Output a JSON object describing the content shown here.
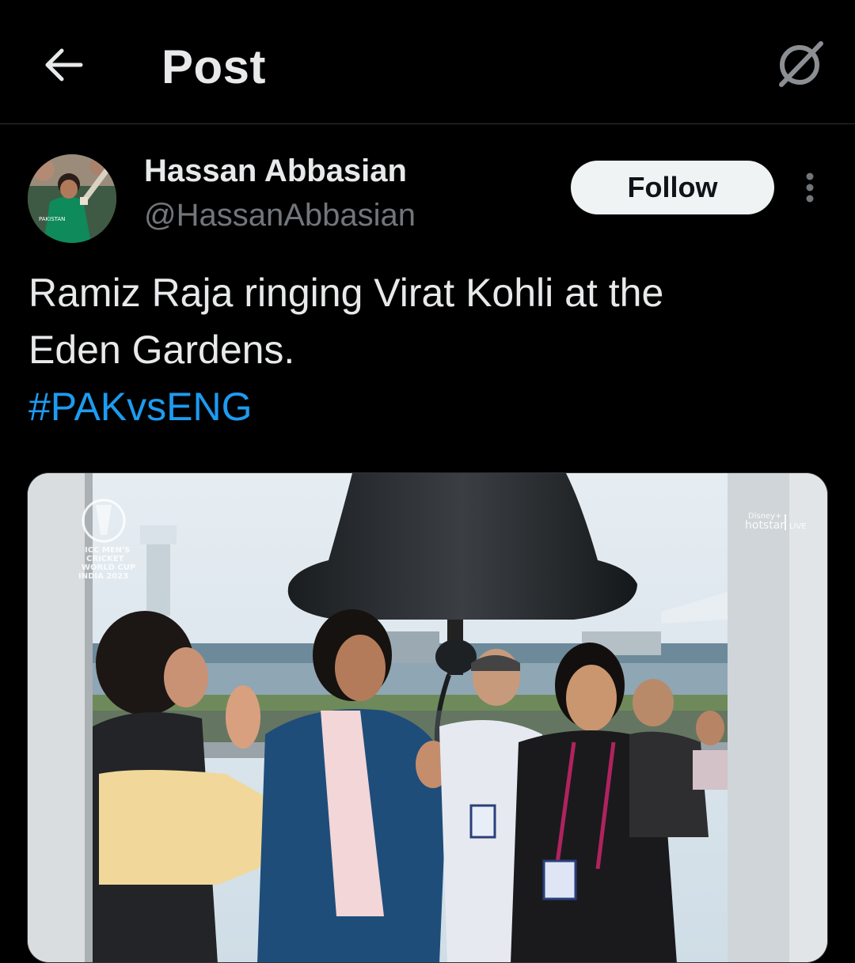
{
  "header": {
    "title": "Post",
    "back_icon": "arrow-left-icon",
    "grok_icon": "grok-icon"
  },
  "author": {
    "name": "Hassan Abbasian",
    "handle": "@HassanAbbasian",
    "avatar_icon": "avatar-photo"
  },
  "follow_label": "Follow",
  "more_icon": "more-vertical-icon",
  "post": {
    "line1": "Ramiz Raja ringing Virat Kohli at the",
    "line2": "Eden Gardens.",
    "hashtag": "#PAKvsENG"
  },
  "media": {
    "logo_text_1": "ICC MEN'S",
    "logo_text_2": "CRICKET",
    "logo_text_3": "WORLD CUP",
    "logo_text_4": "INDIA 2023",
    "broadcaster": "hotstar",
    "broadcaster_sub": "Disney+",
    "live_label": "LIVE"
  },
  "colors": {
    "background": "#000000",
    "text": "#e7e9ea",
    "secondary_text": "#71767b",
    "link": "#1d9bf0",
    "follow_bg": "#eff3f4"
  }
}
